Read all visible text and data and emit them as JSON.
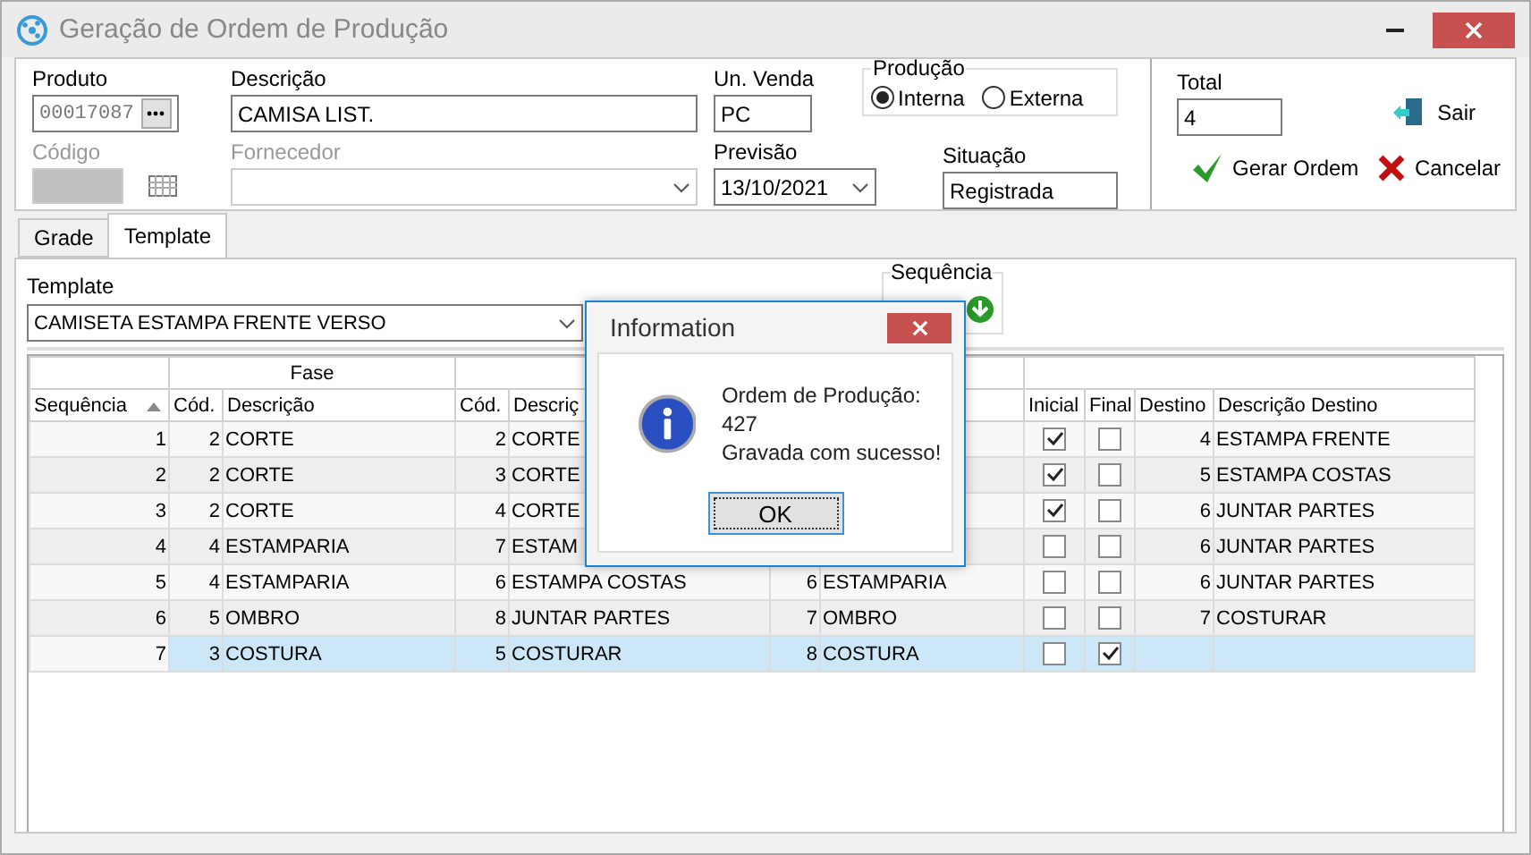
{
  "window": {
    "title": "Geração de Ordem de Produção"
  },
  "form": {
    "produto": {
      "label": "Produto",
      "value": "00017087"
    },
    "descricao": {
      "label": "Descrição",
      "value": "CAMISA LIST."
    },
    "un_venda": {
      "label": "Un. Venda",
      "value": "PC"
    },
    "producao": {
      "label": "Produção",
      "options": [
        {
          "label": "Interna",
          "selected": true
        },
        {
          "label": "Externa",
          "selected": false
        }
      ]
    },
    "codigo": {
      "label": "Código",
      "disabled": true
    },
    "fornecedor": {
      "label": "Fornecedor",
      "disabled": true
    },
    "previsao": {
      "label": "Previsão",
      "value": "13/10/2021"
    },
    "situacao": {
      "label": "Situação",
      "value": "Registrada"
    },
    "total": {
      "label": "Total",
      "value": "4"
    }
  },
  "buttons": [
    {
      "label": "Sair",
      "kind": "exit"
    },
    {
      "label": "Gerar Ordem",
      "kind": "confirm"
    },
    {
      "label": "Cancelar",
      "kind": "cancel"
    }
  ],
  "tabs": [
    {
      "label": "Grade",
      "selected": false
    },
    {
      "label": "Template",
      "selected": true
    }
  ],
  "template": {
    "label": "Template",
    "value": "CAMISETA ESTAMPA FRENTE VERSO"
  },
  "sequence": {
    "label": "Sequência"
  },
  "grid": {
    "group_label": "Fase",
    "columns": [
      {
        "label": "Sequência",
        "sorted": true
      },
      {
        "label": "Cód."
      },
      {
        "label": "Descrição"
      },
      {
        "label": "Cód."
      },
      {
        "label": "Descriç"
      },
      {},
      {},
      {
        "label": "Inicial"
      },
      {
        "label": "Final"
      },
      {
        "label": "Destino"
      },
      {
        "label": "Descrição Destino"
      }
    ],
    "rows": [
      {
        "sequencia": "1",
        "fase_cod": "2",
        "fase_descricao": "CORTE",
        "cod_2": "2",
        "descricao_2": "CORTE",
        "inicial": true,
        "final": false,
        "destino": "4",
        "descricao_destino": "ESTAMPA FRENTE",
        "selected": false
      },
      {
        "sequencia": "2",
        "fase_cod": "2",
        "fase_descricao": "CORTE",
        "cod_2": "3",
        "descricao_2": "CORTE",
        "inicial": true,
        "final": false,
        "destino": "5",
        "descricao_destino": "ESTAMPA COSTAS",
        "selected": false
      },
      {
        "sequencia": "3",
        "fase_cod": "2",
        "fase_descricao": "CORTE",
        "cod_2": "4",
        "descricao_2": "CORTE",
        "inicial": true,
        "final": false,
        "destino": "6",
        "descricao_destino": "JUNTAR PARTES",
        "selected": false
      },
      {
        "sequencia": "4",
        "fase_cod": "4",
        "fase_descricao": "ESTAMPARIA",
        "cod_2": "7",
        "descricao_2": "ESTAM",
        "inicial": false,
        "final": false,
        "destino": "6",
        "descricao_destino": "JUNTAR PARTES",
        "selected": false
      },
      {
        "sequencia": "5",
        "fase_cod": "4",
        "fase_descricao": "ESTAMPARIA",
        "cod_2": "6",
        "descricao_2": "ESTAMPA COSTAS",
        "cod_3": "6",
        "descricao_3": "ESTAMPARIA",
        "inicial": false,
        "final": false,
        "destino": "6",
        "descricao_destino": "JUNTAR PARTES",
        "selected": false
      },
      {
        "sequencia": "6",
        "fase_cod": "5",
        "fase_descricao": "OMBRO",
        "cod_2": "8",
        "descricao_2": "JUNTAR PARTES",
        "cod_3": "7",
        "descricao_3": "OMBRO",
        "inicial": false,
        "final": false,
        "destino": "7",
        "descricao_destino": "COSTURAR",
        "selected": false
      },
      {
        "sequencia": "7",
        "fase_cod": "3",
        "fase_descricao": "COSTURA",
        "cod_2": "5",
        "descricao_2": "COSTURAR",
        "cod_3": "8",
        "descricao_3": "COSTURA",
        "inicial": false,
        "final": true,
        "selected": true
      }
    ]
  },
  "dialog": {
    "title": "Information",
    "message": [
      "Ordem de Produção: 427",
      "Gravada com sucesso!"
    ],
    "button": "OK"
  }
}
